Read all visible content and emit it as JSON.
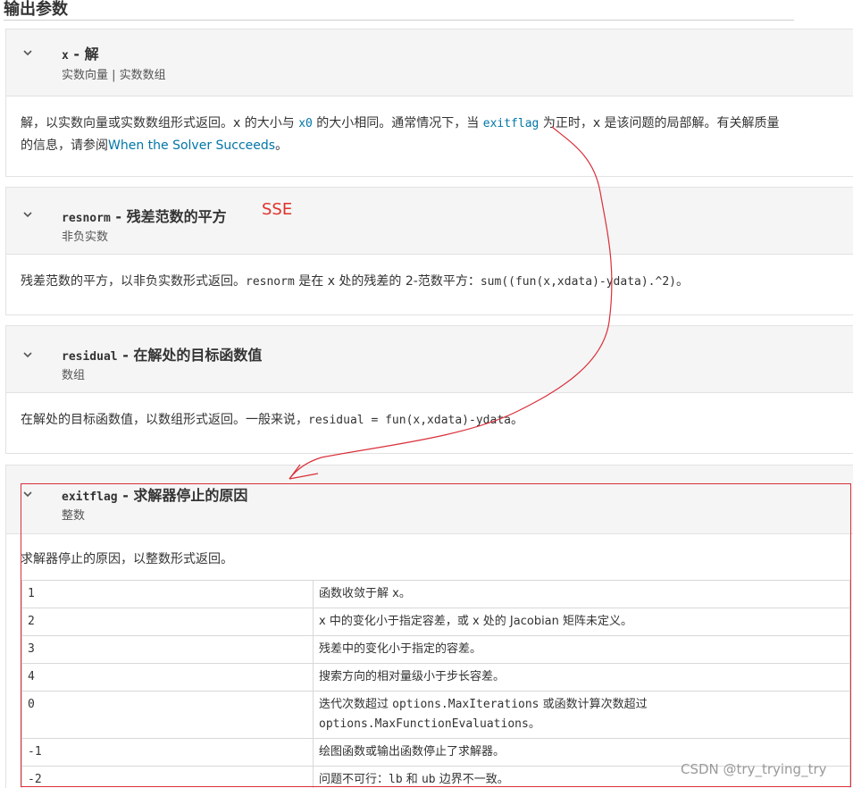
{
  "section": {
    "heading": "输出参数"
  },
  "cards": {
    "x": {
      "name": "x",
      "dash": " - ",
      "title": "解",
      "type": "实数向量 | 实数数组",
      "desc_a": "解，以实数向量或实数数组形式返回。x 的大小与 ",
      "desc_code1": "x0",
      "desc_b": " 的大小相同。通常情况下，当 ",
      "desc_code2": "exitflag",
      "desc_c": " 为正时，x 是该问题的局部解。有关解质量",
      "desc_d": "的信息，请参阅",
      "desc_link": "When the Solver Succeeds",
      "desc_e": "。"
    },
    "resnorm": {
      "name": "resnorm",
      "dash": " - ",
      "title": "残差范数的平方",
      "annotation": "SSE",
      "type": "非负实数",
      "desc_a": "残差范数的平方，以非负实数形式返回。",
      "desc_code1": "resnorm",
      "desc_b": " 是在 x 处的残差的 2-范数平方：",
      "desc_code2": "sum((fun(x,xdata)-ydata).^2)",
      "desc_c": "。"
    },
    "residual": {
      "name": "residual",
      "dash": " - ",
      "title": "在解处的目标函数值",
      "type": "数组",
      "desc_a": "在解处的目标函数值，以数组形式返回。一般来说，",
      "desc_code1": "residual = fun(x,xdata)-ydata",
      "desc_b": "。"
    },
    "exitflag": {
      "name": "exitflag",
      "dash": " - ",
      "title": "求解器停止的原因",
      "type": "整数",
      "desc_a": "求解器停止的原因，以整数形式返回。",
      "rows": [
        {
          "code": "1",
          "meaning": "函数收敛于解 x。"
        },
        {
          "code": "2",
          "meaning": "x 中的变化小于指定容差，或 x 处的 Jacobian 矩阵未定义。"
        },
        {
          "code": "3",
          "meaning": "残差中的变化小于指定的容差。"
        },
        {
          "code": "4",
          "meaning": "搜索方向的相对量级小于步长容差。"
        },
        {
          "code": "0",
          "meaning_a": "迭代次数超过 ",
          "meaning_code1": "options.MaxIterations",
          "meaning_b": " 或函数计算次数超过",
          "meaning_code2": "options.MaxFunctionEvaluations",
          "meaning_c": "。"
        },
        {
          "code": "-1",
          "meaning": "绘图函数或输出函数停止了求解器。"
        },
        {
          "code": "-2",
          "meaning_a": "问题不可行：",
          "meaning_code1": "lb",
          "meaning_b": " 和 ",
          "meaning_code2": "ub",
          "meaning_c": " 边界不一致。"
        }
      ]
    }
  },
  "watermark": "CSDN @try_trying_try",
  "colors": {
    "link": "#0076a8",
    "annotation_red": "#d9303a",
    "header_bg": "#f5f5f5"
  }
}
